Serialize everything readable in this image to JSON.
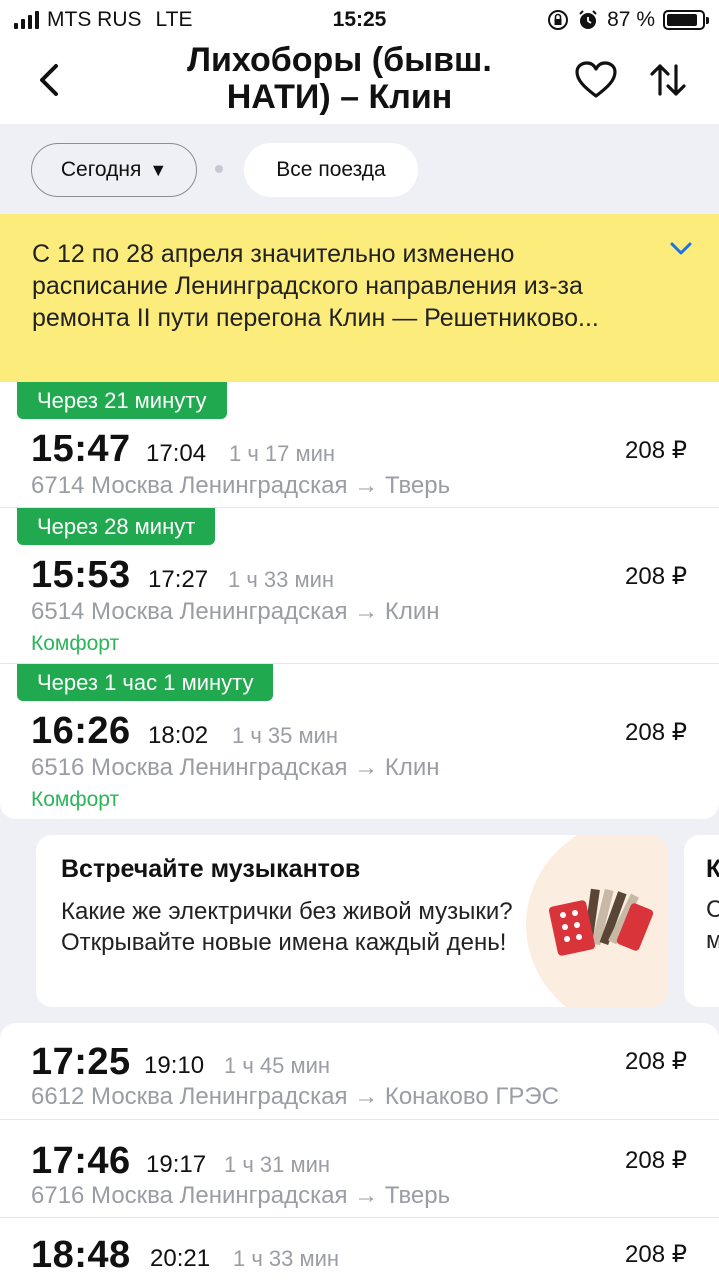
{
  "status_bar": {
    "carrier": "MTS RUS",
    "network": "LTE",
    "time": "15:25",
    "battery": "87 %",
    "battery_level": 0.87
  },
  "header": {
    "title_line1": "Лихоборы (бывш.",
    "title_line2": "НАТИ) – Клин",
    "back_icon": "chevron-left-icon",
    "favorite_icon": "heart-icon",
    "swap_icon": "swap-arrows-icon"
  },
  "filters": {
    "date_label": "Сегодня",
    "date_caret": "▼",
    "trains_label": "Все поезда"
  },
  "notice": {
    "text": "С 12 по 28 апреля значительно изменено расписание Ленинградского направления из-за ремонта II пути перегона Клин — Решетниково...",
    "expand_icon": "chevron-down-icon"
  },
  "trains": [
    {
      "badge": "Через 21 минуту",
      "departure": "15:47",
      "arrival": "17:04",
      "duration": "1 ч 17 мин",
      "route": "6714 Москва Ленинградская → Тверь",
      "comfort": "",
      "price": "208 ₽"
    },
    {
      "badge": "Через 28 минут",
      "departure": "15:53",
      "arrival": "17:27",
      "duration": "1 ч 33 мин",
      "route": "6514 Москва Ленинградская → Клин",
      "comfort": "Комфорт",
      "price": "208 ₽"
    },
    {
      "badge": "Через 1 час 1 минуту",
      "departure": "16:26",
      "arrival": "18:02",
      "duration": "1 ч 35 мин",
      "route": "6516 Москва Ленинградская → Клин",
      "comfort": "Комфорт",
      "price": "208 ₽"
    }
  ],
  "promo": {
    "title": "Встречайте музыкантов",
    "text": "Какие же электрички без живой музыки? Открывайте новые имена каждый день!",
    "art_icon": "accordion-icon",
    "next_title_fragment": "К",
    "next_line2_fragment": "С",
    "next_line3_fragment": "м"
  },
  "trains_more": [
    {
      "departure": "17:25",
      "arrival": "19:10",
      "duration": "1 ч 45 мин",
      "route": "6612 Москва Ленинградская → Конаково ГРЭС",
      "price": "208 ₽"
    },
    {
      "departure": "17:46",
      "arrival": "19:17",
      "duration": "1 ч 31 мин",
      "route": "6716 Москва Ленинградская → Тверь",
      "price": "208 ₽"
    },
    {
      "departure": "18:48",
      "arrival": "20:21",
      "duration": "1 ч 33 мин",
      "route": "",
      "price": "208 ₽"
    }
  ],
  "colors": {
    "accent_green": "#21a94f",
    "comfort_green": "#2bb55b",
    "notice_yellow": "#fcec7c",
    "link_blue": "#1a73e8"
  }
}
